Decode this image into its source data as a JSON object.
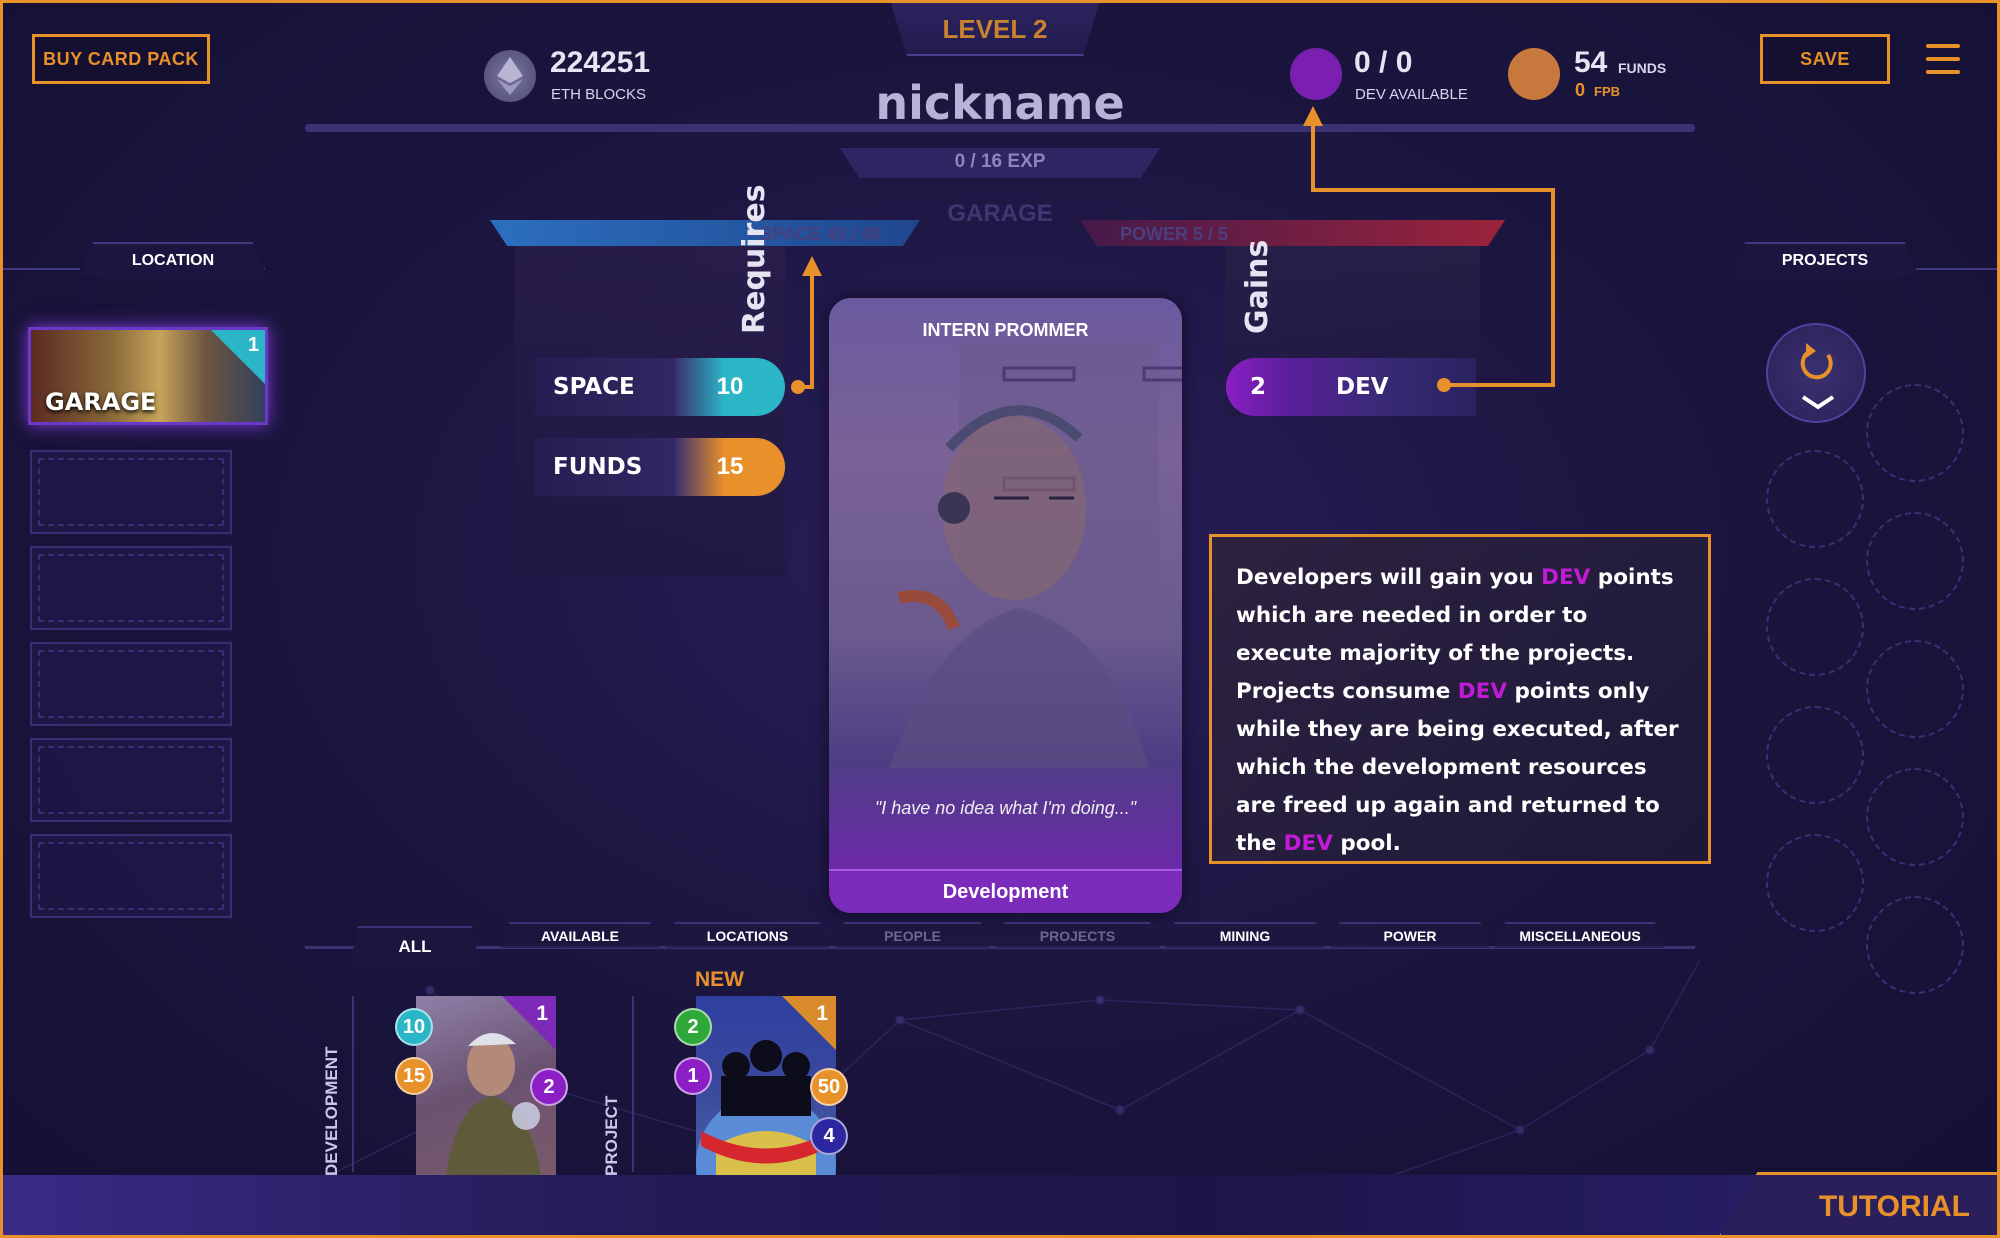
{
  "top": {
    "buy_card_pack": "BUY CARD PACK",
    "save": "SAVE",
    "level": "LEVEL 2",
    "nickname": "nickname",
    "exp": "0 / 16 EXP",
    "location_name_faint": "GARAGE",
    "eth_blocks_value": "224251",
    "eth_blocks_label": "ETH BLOCKS",
    "dev_value": "0 / 0",
    "dev_label": "DEV AVAILABLE",
    "funds_value": "54",
    "funds_unit": "FUNDS",
    "fpb_value": "0",
    "fpb_unit": "FPB"
  },
  "location_panel": {
    "title": "LOCATION",
    "cards": [
      {
        "name": "GARAGE",
        "count": "1"
      }
    ],
    "empty_slots": 5
  },
  "projects_panel": {
    "title": "PROJECTS"
  },
  "bars": {
    "space": "SPACE 40 / 40",
    "power": "POWER  5 / 5"
  },
  "requires": {
    "label": "Requires",
    "items": [
      {
        "name": "SPACE",
        "value": "10"
      },
      {
        "name": "FUNDS",
        "value": "15"
      }
    ]
  },
  "gains": {
    "label": "Gains",
    "items": [
      {
        "value": "2",
        "name": "DEV"
      }
    ]
  },
  "card": {
    "title": "INTERN PROMMER",
    "quote": "\"I have no idea what I'm doing...\"",
    "type": "Development"
  },
  "tooltip": {
    "p1": "Developers will gain you ",
    "hl1": "DEV",
    "p2": " points which are needed in order to execute majority of the projects. Projects consume ",
    "hl2": "DEV",
    "p3": " points only while they are being executed, after which the development resources are freed up again and returned to the ",
    "hl3": "DEV",
    "p4": " pool."
  },
  "tabs": [
    "ALL",
    "AVAILABLE",
    "LOCATIONS",
    "PEOPLE",
    "PROJECTS",
    "MINING",
    "POWER",
    "MISCELLANEOUS"
  ],
  "hand": {
    "dev_category": "DEVELOPMENT",
    "project_category": "PROJECT",
    "new_label": "NEW",
    "dev_card": {
      "count": "1",
      "space": "10",
      "funds": "15",
      "dev": "2"
    },
    "project_card": {
      "count": "1",
      "a": "2",
      "b": "1",
      "c": "50",
      "d": "4"
    }
  },
  "tutorial": "TUTORIAL",
  "colors": {
    "accent": "#e8912a",
    "dev": "#c21bd6",
    "space": "#2bb6c8",
    "funds": "#e8912a"
  }
}
